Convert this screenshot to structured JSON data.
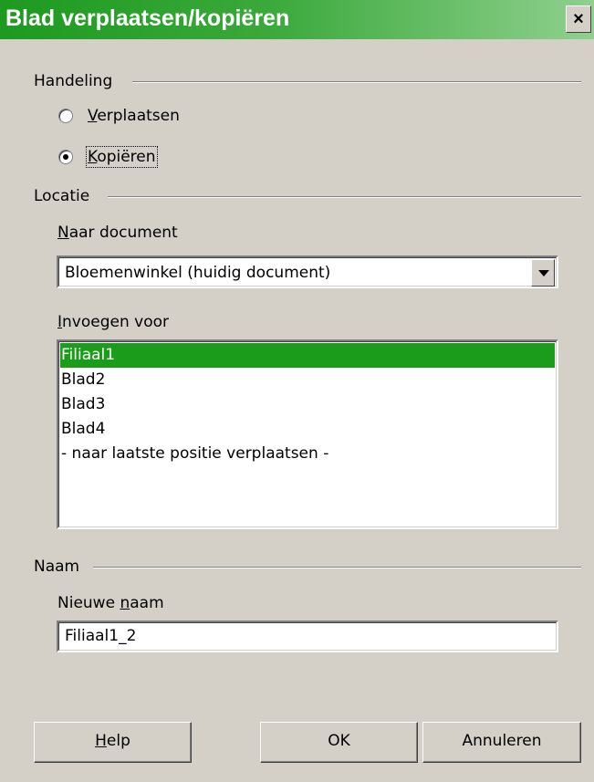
{
  "window": {
    "title": "Blad verplaatsen/kopiëren",
    "close_glyph": "×"
  },
  "handeling": {
    "label": "Handeling",
    "options": [
      {
        "label": "Verplaatsen",
        "mnemonic": "V",
        "rest": "erplaatsen",
        "checked": false
      },
      {
        "label": "Kopiëren",
        "mnemonic": "K",
        "rest": "opiëren",
        "checked": true
      }
    ]
  },
  "locatie": {
    "label": "Locatie",
    "naar_document": {
      "label": "Naar document",
      "mnemonic": "N",
      "rest": "aar document",
      "value": "Bloemenwinkel (huidig document)"
    },
    "invoegen_voor": {
      "label": "Invoegen voor",
      "mnemonic": "I",
      "rest": "nvoegen voor",
      "items": [
        "Filiaal1",
        "Blad2",
        "Blad3",
        "Blad4",
        "- naar laatste positie verplaatsen -"
      ],
      "selected_index": 0
    }
  },
  "naam": {
    "label": "Naam",
    "nieuwe_naam": {
      "label": "Nieuwe naam",
      "prefix": "Nieuwe ",
      "mnemonic": "n",
      "rest": "aam",
      "value": "Filiaal1_2"
    }
  },
  "buttons": {
    "help": {
      "label": "Help",
      "mnemonic": "H",
      "rest": "elp"
    },
    "ok": {
      "label": "OK"
    },
    "cancel": {
      "label": "Annuleren"
    }
  },
  "colors": {
    "title_gradient_start": "#1d9a1f",
    "selection": "#1b9c1b",
    "dialog_bg": "#d4d0c8"
  }
}
